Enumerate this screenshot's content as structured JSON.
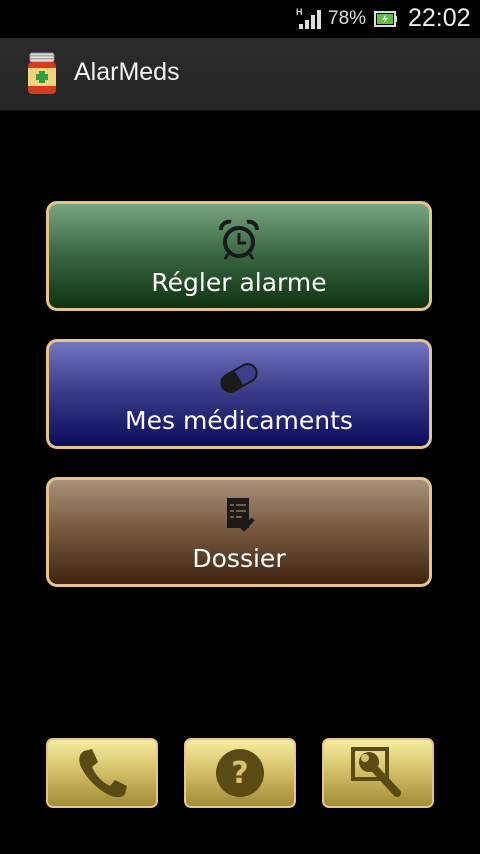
{
  "status_bar": {
    "network_type": "H",
    "battery_percent": "78%",
    "time": "22:02"
  },
  "action_bar": {
    "app_title": "AlarMeds",
    "app_icon": "pill-bottle-icon"
  },
  "main_buttons": [
    {
      "label": "Régler alarme",
      "icon": "alarm-clock-icon"
    },
    {
      "label": "Mes médicaments",
      "icon": "capsule-icon"
    },
    {
      "label": "Dossier",
      "icon": "checklist-icon"
    }
  ],
  "tool_buttons": [
    {
      "icon": "phone-icon"
    },
    {
      "icon": "help-icon"
    },
    {
      "icon": "settings-wrench-icon"
    }
  ],
  "colors": {
    "border_gold": "#e8c38a",
    "alarm_green": "#3e6a45",
    "meds_blue": "#3d3f8c",
    "dossier_brown": "#7a5c42",
    "tool_gold": "#d5c26a"
  }
}
